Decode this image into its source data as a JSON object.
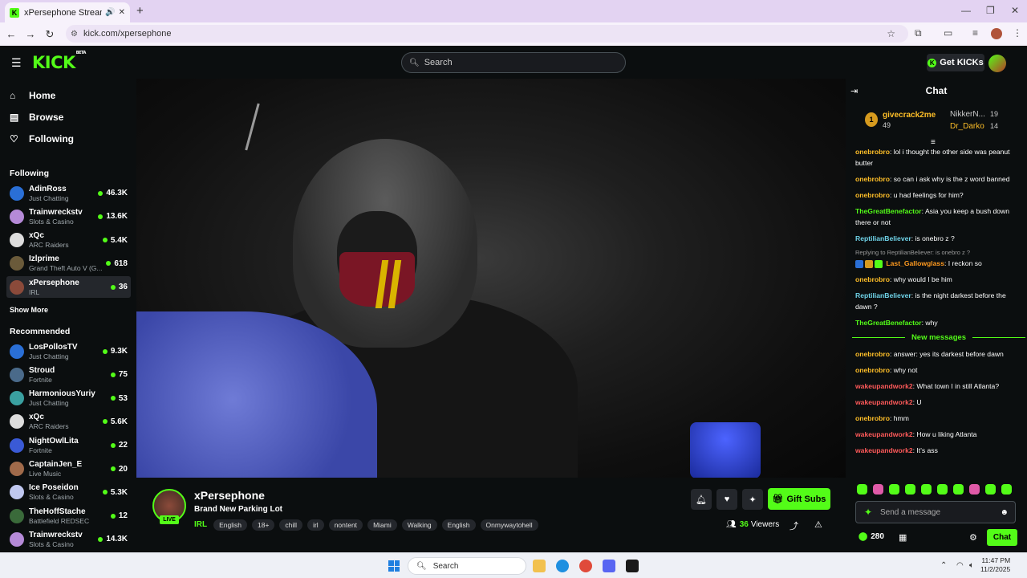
{
  "browser": {
    "tab_title": "xPersephone Stream - Wat",
    "url": "kick.com/xpersephone",
    "new_tab": "+",
    "favicon_letter": "K"
  },
  "header": {
    "logo": "KICK",
    "logo_sup": "BETA",
    "search_placeholder": "Search",
    "get_kicks": "Get KICKs"
  },
  "sidebar": {
    "nav": [
      {
        "label": "Home",
        "icon": "home-icon"
      },
      {
        "label": "Browse",
        "icon": "browse-icon"
      },
      {
        "label": "Following",
        "icon": "heart-icon"
      }
    ],
    "following_heading": "Following",
    "following": [
      {
        "name": "AdinRoss",
        "category": "Just Chatting",
        "viewers": "46.3K",
        "color": "#2a6fd6"
      },
      {
        "name": "Trainwreckstv",
        "category": "Slots & Casino",
        "viewers": "13.6K",
        "color": "#b58ad8"
      },
      {
        "name": "xQc",
        "category": "ARC Raiders",
        "viewers": "5.4K",
        "color": "#dddddd"
      },
      {
        "name": "Izlprime",
        "category": "Grand Theft Auto V (G...",
        "viewers": "618",
        "color": "#6a5a3a"
      },
      {
        "name": "xPersephone",
        "category": "IRL",
        "viewers": "36",
        "color": "#8b4a3a"
      }
    ],
    "show_more": "Show More",
    "recommended_heading": "Recommended",
    "recommended": [
      {
        "name": "LosPollosTV",
        "category": "Just Chatting",
        "viewers": "9.3K",
        "color": "#2a6fd6"
      },
      {
        "name": "Stroud",
        "category": "Fortnite",
        "viewers": "75",
        "color": "#4a6a8a"
      },
      {
        "name": "HarmoniousYuriy",
        "category": "Just Chatting",
        "viewers": "53",
        "color": "#3aa0a0"
      },
      {
        "name": "xQc",
        "category": "ARC Raiders",
        "viewers": "5.6K",
        "color": "#dddddd"
      },
      {
        "name": "NightOwlLita",
        "category": "Fortnite",
        "viewers": "22",
        "color": "#3a5ad6"
      },
      {
        "name": "CaptainJen_E",
        "category": "Live Music",
        "viewers": "20",
        "color": "#a06a4a"
      },
      {
        "name": "Ice Poseidon",
        "category": "Slots & Casino",
        "viewers": "5.3K",
        "color": "#c0c8f0"
      },
      {
        "name": "TheHoffStache",
        "category": "Battlefield REDSEC",
        "viewers": "12",
        "color": "#3a6a3a"
      },
      {
        "name": "Trainwreckstv",
        "category": "Slots & Casino",
        "viewers": "14.3K",
        "color": "#b58ad8"
      }
    ]
  },
  "stream": {
    "streamer": "xPersephone",
    "title": "Brand New Parking Lot",
    "category": "IRL",
    "live_label": "LIVE",
    "tags": [
      "English",
      "18+",
      "chill",
      "irl",
      "nontent",
      "Miami",
      "Walking",
      "English",
      "Onmywaytohell"
    ],
    "gift_subs": "Gift Subs",
    "viewers": "36",
    "viewers_label": "Viewers"
  },
  "chat": {
    "heading": "Chat",
    "leaderboard": [
      {
        "rank": "1",
        "name": "givecrack2me",
        "count": "49"
      },
      {
        "name": "NikkerN...",
        "count": "19"
      },
      {
        "name": "Dr_Darko",
        "count": "14"
      }
    ],
    "messages": [
      {
        "user": "onebrobro",
        "color": "#ffbf28",
        "text": "lol i thought the other side was peanut butter"
      },
      {
        "user": "onebrobro",
        "color": "#ffbf28",
        "text": "so can i ask why is the z word banned"
      },
      {
        "user": "onebrobro",
        "color": "#ffbf28",
        "text": "u had feelings for him?"
      },
      {
        "user": "TheGreatBenefactor",
        "color": "#53fc18",
        "text": "Asia you keep a bush down there or not"
      },
      {
        "user": "ReptilianBeliever",
        "color": "#6fd3e8",
        "text": "is onebro z ?"
      }
    ],
    "reply": {
      "context": "Replying to ReptilianBeliever: is onebro z ?",
      "user": "Last_Gallowglass",
      "color": "#ff9a1f",
      "text": "I reckon so"
    },
    "messages2": [
      {
        "user": "onebrobro",
        "color": "#ffbf28",
        "text": "why would I be him"
      },
      {
        "user": "ReptilianBeliever",
        "color": "#6fd3e8",
        "text": "is the night darkest before the dawn ?"
      },
      {
        "user": "TheGreatBenefactor",
        "color": "#53fc18",
        "text": "why"
      }
    ],
    "new_messages_label": "New messages",
    "messages3": [
      {
        "user": "onebrobro",
        "color": "#ffbf28",
        "text": "answer: yes its darkest before dawn"
      },
      {
        "user": "onebrobro",
        "color": "#ffbf28",
        "text": "why not"
      },
      {
        "user": "wakeupandwork2",
        "color": "#ff5a5a",
        "text": "What town I in still Atlanta?"
      },
      {
        "user": "wakeupandwork2",
        "color": "#ff5a5a",
        "text": "U"
      },
      {
        "user": "onebrobro",
        "color": "#ffbf28",
        "text": "hmm"
      },
      {
        "user": "wakeupandwork2",
        "color": "#ff5a5a",
        "text": "How u liking Atlanta"
      },
      {
        "user": "wakeupandwork2",
        "color": "#ff5a5a",
        "text": "It's ass"
      }
    ],
    "input_placeholder": "Send a message",
    "points": "280",
    "chat_button": "Chat"
  },
  "taskbar": {
    "search": "Search",
    "time": "11:47 PM",
    "date": "11/2/2025"
  }
}
